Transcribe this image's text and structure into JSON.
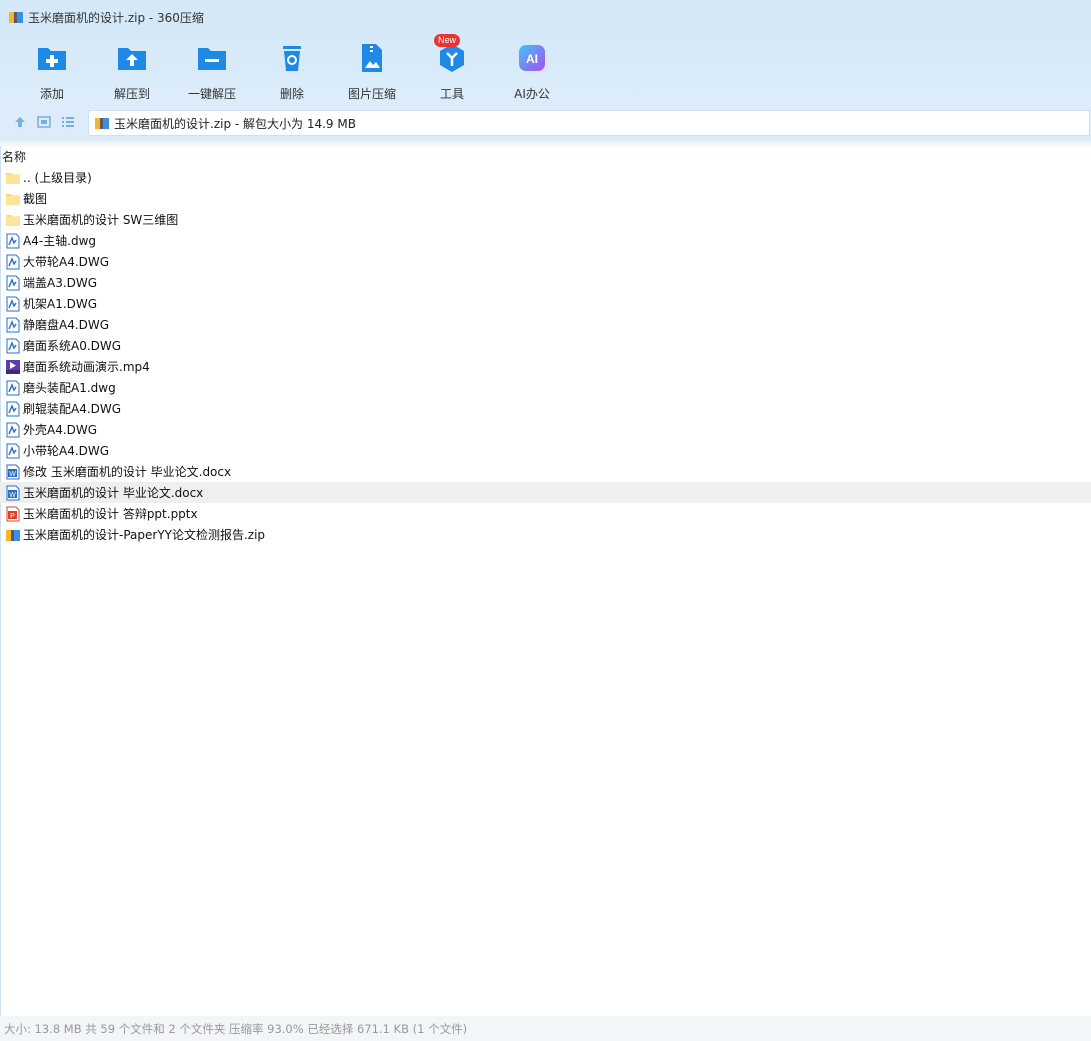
{
  "window": {
    "title": "玉米磨面机的设计.zip - 360压缩"
  },
  "toolbar": {
    "items": [
      {
        "label": "添加",
        "icon": "add-folder-icon"
      },
      {
        "label": "解压到",
        "icon": "extract-to-icon"
      },
      {
        "label": "一键解压",
        "icon": "one-click-extract-icon"
      },
      {
        "label": "删除",
        "icon": "delete-icon"
      },
      {
        "label": "图片压缩",
        "icon": "image-compress-icon"
      },
      {
        "label": "工具",
        "icon": "tools-icon",
        "badge": "New"
      },
      {
        "label": "AI办公",
        "icon": "ai-office-icon"
      }
    ]
  },
  "address": {
    "path": "玉米磨面机的设计.zip - 解包大小为 14.9 MB"
  },
  "list": {
    "header": "名称",
    "files": [
      {
        "name": ".. (上级目录)",
        "type": "folder"
      },
      {
        "name": "截图",
        "type": "folder"
      },
      {
        "name": "玉米磨面机的设计 SW三维图",
        "type": "folder"
      },
      {
        "name": "A4-主轴.dwg",
        "type": "dwg"
      },
      {
        "name": "大带轮A4.DWG",
        "type": "dwg"
      },
      {
        "name": "端盖A3.DWG",
        "type": "dwg"
      },
      {
        "name": "机架A1.DWG",
        "type": "dwg"
      },
      {
        "name": "静磨盘A4.DWG",
        "type": "dwg"
      },
      {
        "name": "磨面系统A0.DWG",
        "type": "dwg"
      },
      {
        "name": "磨面系统动画演示.mp4",
        "type": "mp4"
      },
      {
        "name": "磨头装配A1.dwg",
        "type": "dwg"
      },
      {
        "name": "刷辊装配A4.DWG",
        "type": "dwg"
      },
      {
        "name": "外壳A4.DWG",
        "type": "dwg"
      },
      {
        "name": "小带轮A4.DWG",
        "type": "dwg"
      },
      {
        "name": "修改 玉米磨面机的设计 毕业论文.docx",
        "type": "docx"
      },
      {
        "name": "玉米磨面机的设计 毕业论文.docx",
        "type": "docx",
        "selected": true
      },
      {
        "name": "玉米磨面机的设计 答辩ppt.pptx",
        "type": "pptx"
      },
      {
        "name": "玉米磨面机的设计-PaperYY论文检测报告.zip",
        "type": "zip"
      }
    ]
  },
  "status": {
    "text": "大小: 13.8 MB 共 59 个文件和 2 个文件夹 压缩率 93.0% 已经选择 671.1 KB (1 个文件)"
  },
  "colors": {
    "toolbar_bg": "#d6e9f9",
    "icon_blue": "#1f8ae6",
    "selected_row": "#efefef",
    "new_badge": "#e8362f"
  }
}
